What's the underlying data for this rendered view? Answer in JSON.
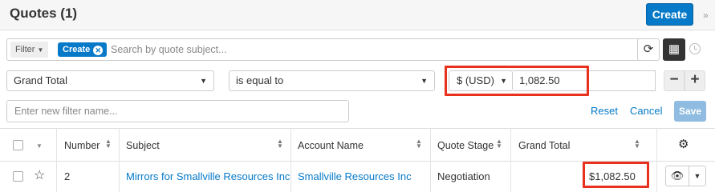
{
  "header": {
    "title": "Quotes (1)",
    "create_label": "Create"
  },
  "filter_bar": {
    "filter_dropdown_label": "Filter",
    "active_pill_label": "Create",
    "search_placeholder": "Search by quote subject..."
  },
  "filter_row": {
    "field": "Grand Total",
    "operator": "is equal to",
    "currency": "$ (USD)",
    "amount": "1,082.50"
  },
  "filter_name": {
    "placeholder": "Enter new filter name...",
    "reset_label": "Reset",
    "cancel_label": "Cancel",
    "save_label": "Save"
  },
  "table": {
    "columns": [
      "Number",
      "Subject",
      "Account Name",
      "Quote Stage",
      "Grand Total"
    ],
    "rows": [
      {
        "number": "2",
        "subject": "Mirrors for Smallville Resources Inc",
        "account": "Smallville Resources Inc",
        "stage": "Negotiation",
        "total": "$1,082.50"
      }
    ]
  },
  "colors": {
    "accent": "#0679c8",
    "highlight": "#e8321d"
  }
}
